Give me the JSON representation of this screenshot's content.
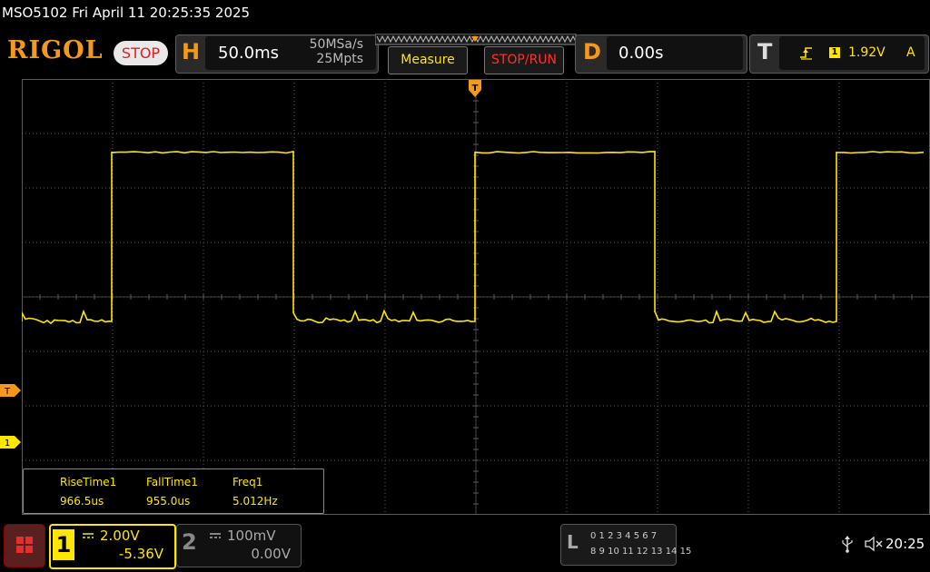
{
  "top_title": "MSO5102  Fri April 11 20:25:35 2025",
  "header": {
    "logo": "RIGOL",
    "run_state": "STOP",
    "horizontal": {
      "letter": "H",
      "timebase": "50.0ms",
      "sample_rate": "50MSa/s",
      "memory_depth": "25Mpts"
    },
    "measure_label": "Measure",
    "stoprun_label": "STOP/RUN",
    "delay": {
      "letter": "D",
      "value": "0.00s"
    },
    "trigger": {
      "letter": "T",
      "source": "1",
      "level": "1.92V",
      "mode": "A"
    }
  },
  "markers": {
    "trigger_marker": "T",
    "channel1_marker": "1"
  },
  "measurements": {
    "headers": [
      "RiseTime1",
      "FallTime1",
      "Freq1"
    ],
    "values": [
      "966.5us",
      "955.0us",
      "5.012Hz"
    ]
  },
  "channels": [
    {
      "number": "1",
      "scale": "2.00V",
      "offset": "-5.36V",
      "active": true
    },
    {
      "number": "2",
      "scale": "100mV",
      "offset": "0.00V",
      "active": false
    }
  ],
  "logic_analyzer": {
    "letter": "L",
    "row1": "0 1 2 3  4 5 6 7",
    "row2": "8 9 10 11 12 13 14 15"
  },
  "clock": "20:25",
  "colors": {
    "ch1": "#ffe600",
    "accent": "#f39a1a",
    "stop": "#e02020"
  },
  "icons": [
    "menu-icon",
    "usb-icon",
    "mute-speaker-icon",
    "trigger-edge-icon"
  ]
}
